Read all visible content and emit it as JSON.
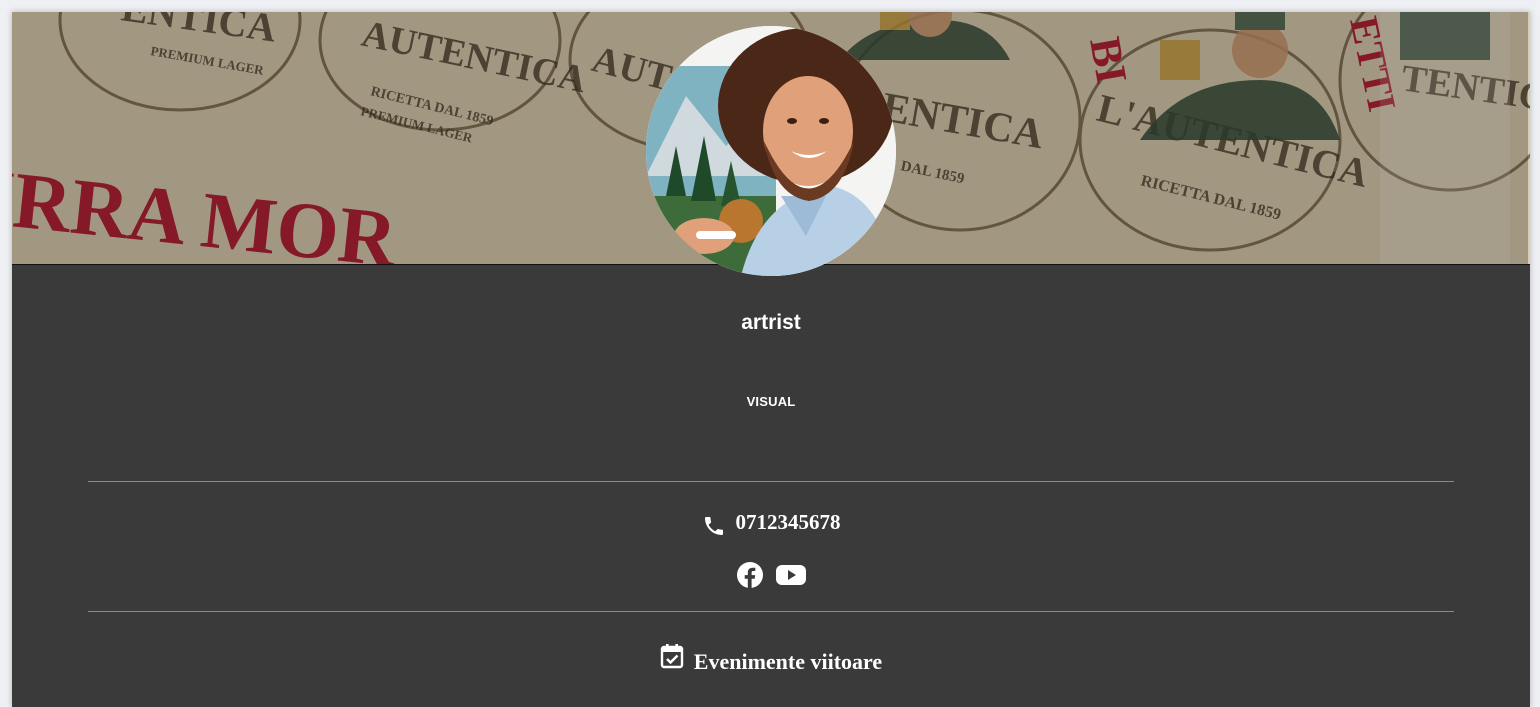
{
  "profile": {
    "name": "artrist",
    "category": "VISUAL"
  },
  "banner": {
    "background_texts": [
      "L'AUTENTICA",
      "RICETTA DAL 1859",
      "PREMIUM LAGER",
      "IRRA MORE"
    ],
    "accent_color": "#b01e33"
  },
  "contact": {
    "phone_icon": "phone-icon",
    "phone": "0712345678"
  },
  "social": {
    "items": [
      {
        "icon": "facebook-icon"
      },
      {
        "icon": "youtube-icon"
      }
    ]
  },
  "events": {
    "icon": "calendar-check-icon",
    "title": "Evenimente viitoare"
  },
  "colors": {
    "page_bg": "#3a3a3a",
    "text": "#ffffff",
    "divider": "#8a8a8a"
  }
}
